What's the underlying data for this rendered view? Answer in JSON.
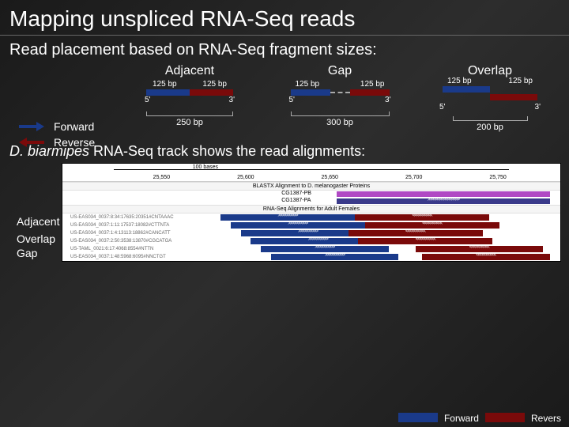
{
  "title": "Mapping unspliced RNA-Seq reads",
  "subtitle": "Read placement based on RNA-Seq fragment sizes:",
  "legend": {
    "forward": "Forward",
    "reverse": "Reverse"
  },
  "columns": {
    "adjacent": {
      "title": "Adjacent",
      "read_f": "125 bp",
      "read_r": "125 bp",
      "five": "5'",
      "three": "3'",
      "total": "250 bp"
    },
    "gap": {
      "title": "Gap",
      "read_f": "125 bp",
      "read_r": "125 bp",
      "five": "5'",
      "three": "3'",
      "total": "300 bp"
    },
    "overlap": {
      "title": "Overlap",
      "read_f": "125 bp",
      "read_r": "125 bp",
      "five": "5'",
      "three": "3'",
      "total": "200 bp"
    }
  },
  "section2": {
    "species": "D. biarmipes",
    "rest": " RNA-Seq track shows the read alignments:"
  },
  "track": {
    "scale_label": "100 bases",
    "ticks": [
      "25,550",
      "25,600",
      "25,650",
      "25,700",
      "25,750"
    ],
    "subhead1": "BLASTX Alignment to D. melanogaster Proteins",
    "gene1": "CG1387-PB",
    "gene2": "CG1387-PA",
    "subhead2": "RNA-Seq Alignments for Adult Females",
    "reads": [
      "US-EAS034_0037:8:34:17635:20351#CNTAAAC",
      "US-EAS034_0037:1:11:17537:18082#CTTNTA",
      "US-EAS034_0037:1:4:13113:18862#CANCATT",
      "US-EAS034_0037:2:50:3538:13870#CGCATGA",
      "US-TAML_0021:6:17:4068:8554#NTTN",
      "US-EAS034_0037:1:48:5968:6095#NNCTGT"
    ],
    "row_labels": {
      "adjacent": "Adjacent",
      "overlap": "Overlap",
      "gap": "Gap"
    }
  },
  "bottom_legend": {
    "forward": "Forward",
    "reverse": "Revers"
  },
  "colors": {
    "forward": "#1a3a8a",
    "reverse": "#7a0a0a"
  }
}
